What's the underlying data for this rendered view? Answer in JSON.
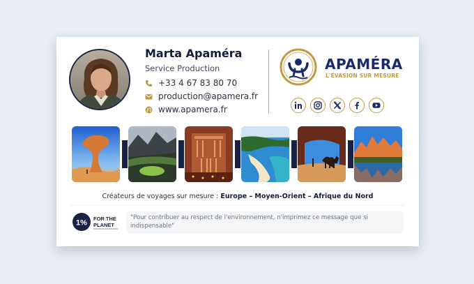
{
  "signature": {
    "name": "Marta Apaméra",
    "role": "Service Production",
    "phone": "+33 4 67 83 80 70",
    "email": "production@apamera.fr",
    "website": "www.apamera.fr",
    "icons": [
      "phone-icon",
      "email-icon",
      "globe-icon"
    ]
  },
  "brand": {
    "name": "APAMÉRA",
    "tagline": "L'ÉVASION SUR MESURE",
    "colors": {
      "navy": "#1a2a6c",
      "gold": "#c29a3e"
    }
  },
  "socials": [
    "linkedin-icon",
    "instagram-icon",
    "x-icon",
    "facebook-icon",
    "youtube-icon"
  ],
  "photos": [
    "mushroom-rock-desert",
    "green-mountain-landscape",
    "petra-treasury",
    "tropical-lagoon-beach",
    "wadi-rum-camel",
    "dolomites-lake"
  ],
  "footer": {
    "creators_prefix": "Créateurs de voyages sur mesure : ",
    "creators_destinations": "Europe – Moyen-Orient – Afrique du Nord",
    "badge_number": "1%",
    "badge_line1": "FOR THE",
    "badge_line2": "PLANET",
    "eco_message": "\"Pour contribuer au respect de l'environnement, n'imprimez ce message que si indispensable\""
  }
}
